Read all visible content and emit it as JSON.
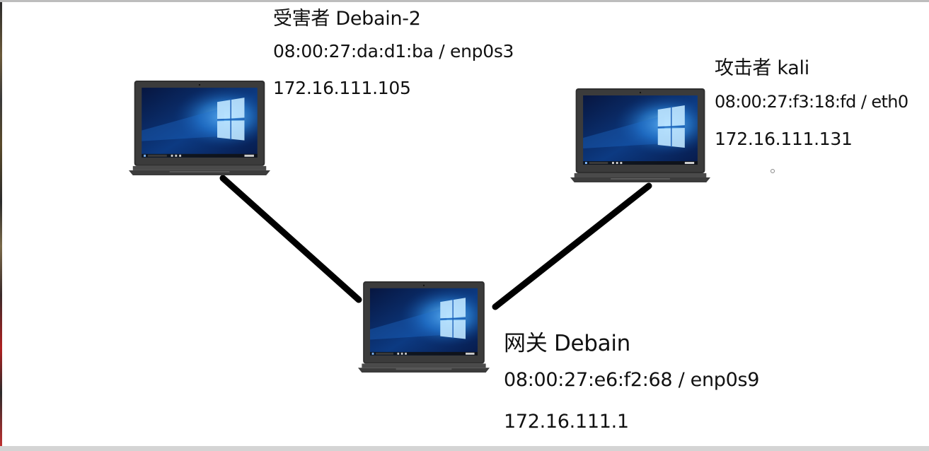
{
  "nodes": {
    "victim": {
      "title": "受害者 Debain-2",
      "mac": "08:00:27:da:d1:ba / enp0s3",
      "ip": "172.16.111.105"
    },
    "attacker": {
      "title": "攻击者 kali",
      "mac": "08:00:27:f3:18:fd / eth0",
      "ip": "172.16.111.131"
    },
    "gateway": {
      "title": "网关 Debain",
      "mac": "08:00:27:e6:f2:68 / enp0s9",
      "ip": "172.16.111.1"
    }
  },
  "icons": {
    "computer": "laptop-windows-10-icon"
  },
  "colors": {
    "link": "#000000",
    "laptop_body": "#3a3a3a",
    "screen_dark": "#0a1e4a",
    "screen_light": "#3aa0f0",
    "background": "#ffffff"
  }
}
